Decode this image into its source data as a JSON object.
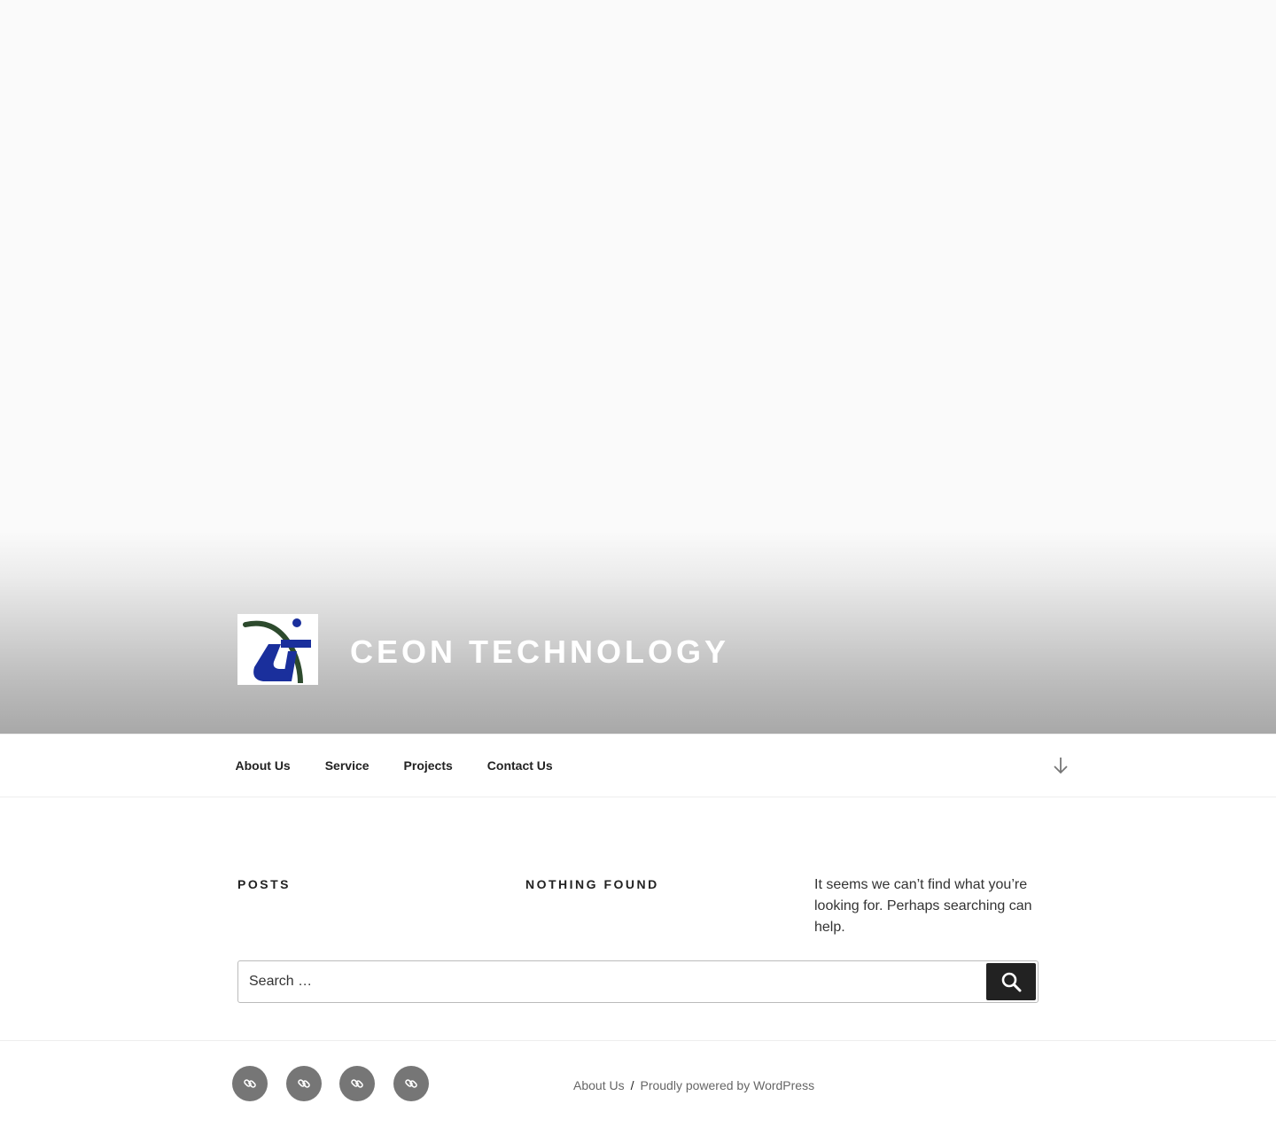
{
  "header": {
    "site_title": "CEON TECHNOLOGY",
    "logo_icon": "ceon-logo-icon"
  },
  "nav": {
    "items": [
      {
        "label": "About Us"
      },
      {
        "label": "Service"
      },
      {
        "label": "Projects"
      },
      {
        "label": "Contact Us"
      }
    ],
    "scroll_icon": "arrow-down-icon"
  },
  "content": {
    "posts_heading": "Posts",
    "nothing_found_heading": "Nothing Found",
    "nothing_found_text": "It seems we can’t find what you’re looking for. Perhaps searching can help."
  },
  "search": {
    "placeholder": "Search …",
    "button_icon": "search-icon"
  },
  "footer": {
    "social_icons": [
      "link-icon",
      "link-icon",
      "link-icon",
      "link-icon"
    ],
    "about_link": "About Us",
    "separator": "/",
    "powered_by": "Proudly powered by WordPress"
  },
  "colors": {
    "logo_blue": "#1a2f9c",
    "logo_green": "#2d4a2d",
    "social_bg": "#767676",
    "button_bg": "#222222"
  }
}
